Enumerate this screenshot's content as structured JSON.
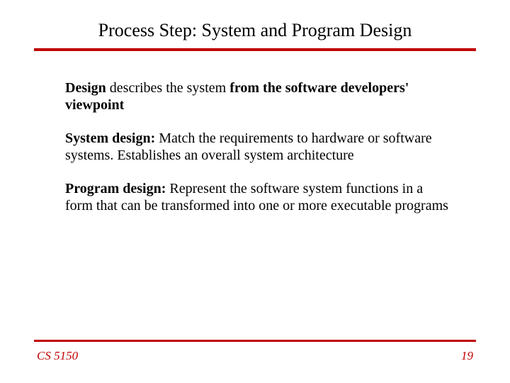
{
  "title": "Process Step: System and Program Design",
  "paragraphs": {
    "p1": {
      "b1": "Design",
      "t1": " describes the system ",
      "b2": "from the software developers' viewpoint"
    },
    "p2": {
      "b1": "System design:",
      "t1": "  Match the requirements to hardware or software systems.  Establishes an overall system architecture"
    },
    "p3": {
      "b1": "Program design:",
      "t1": " Represent the software system functions in a form that can be transformed into one or more executable programs"
    }
  },
  "footer": {
    "course": "CS 5150",
    "page": "19"
  },
  "colors": {
    "rule": "#c00000",
    "footer_text": "#c00000"
  }
}
